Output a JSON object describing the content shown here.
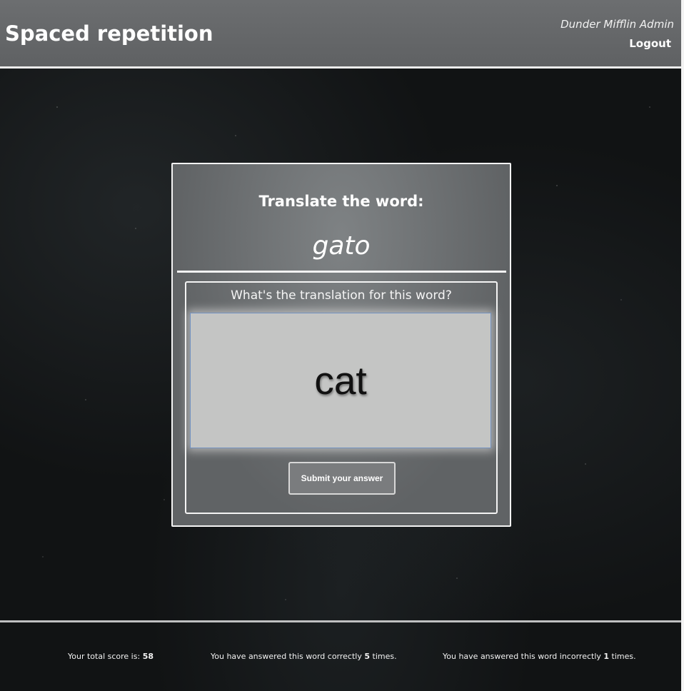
{
  "header": {
    "title": "Spaced repetition",
    "user_name": "Dunder Mifflin Admin",
    "logout_label": "Logout"
  },
  "card": {
    "heading": "Translate the word:",
    "word": "gato",
    "prompt": "What's the translation for this word?",
    "answer_value": "cat",
    "submit_label": "Submit your answer"
  },
  "footer": {
    "score_prefix": "Your total score is:",
    "score": "58",
    "correct_prefix": "You have answered this word correctly",
    "correct_count": "5",
    "correct_suffix": "times.",
    "incorrect_prefix": "You have answered this word incorrectly",
    "incorrect_count": "1",
    "incorrect_suffix": "times."
  },
  "colors": {
    "header_bg": "#65676a",
    "page_bg": "#111314",
    "card_bg": "#6a6c6e",
    "input_bg": "#c4c5c4",
    "input_border": "#6f8fbf",
    "text": "#ffffff"
  }
}
